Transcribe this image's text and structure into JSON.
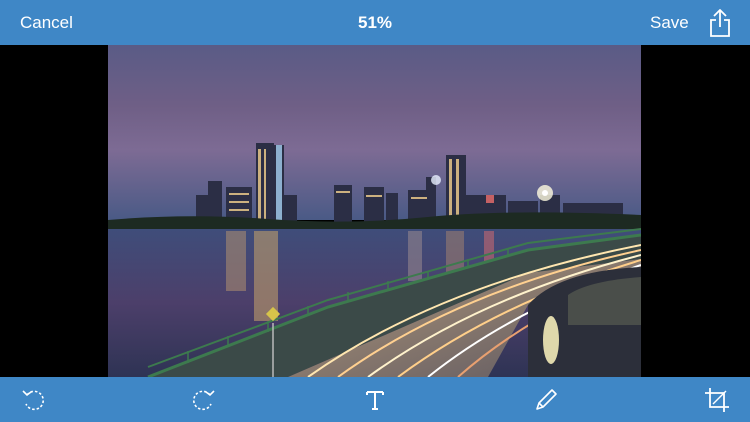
{
  "header": {
    "cancel_label": "Cancel",
    "zoom_level": "51%",
    "save_label": "Save",
    "share_icon": "share-icon"
  },
  "photo": {
    "subject": "city-skyline-night-long-exposure"
  },
  "toolbar": {
    "tools": [
      "rotate-left-icon",
      "rotate-right-icon",
      "text-icon",
      "pencil-icon",
      "crop-icon"
    ]
  },
  "colors": {
    "bar": "#3f87c6",
    "text": "#ffffff"
  }
}
